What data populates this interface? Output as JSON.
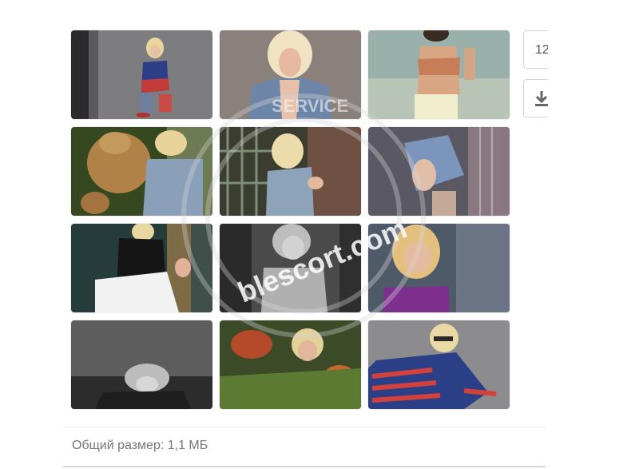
{
  "gallery": {
    "photos": [
      {
        "label": "Blonde girl in flag sweater standing by wall"
      },
      {
        "label": "Blonde girl in denim jacket"
      },
      {
        "label": "Girl in bandeau top"
      },
      {
        "label": "Girl hugging teddy bear"
      },
      {
        "label": "Girl leaning on gate"
      },
      {
        "label": "Girl by window in shirt"
      },
      {
        "label": "Girl in white jacket"
      },
      {
        "label": "Black and white portrait"
      },
      {
        "label": "Blonde girl in purple top"
      },
      {
        "label": "Grayscale girl lying down"
      },
      {
        "label": "Girl in flowers"
      },
      {
        "label": "Girl in flag sweater with sunglasses"
      }
    ]
  },
  "side": {
    "count_label": "12",
    "download_icon": "download-icon"
  },
  "watermark": {
    "site_text": "blescort.com",
    "ring_text": "SERVICE"
  },
  "footer": {
    "total_size": "Общий размер: 1,1 МБ"
  }
}
